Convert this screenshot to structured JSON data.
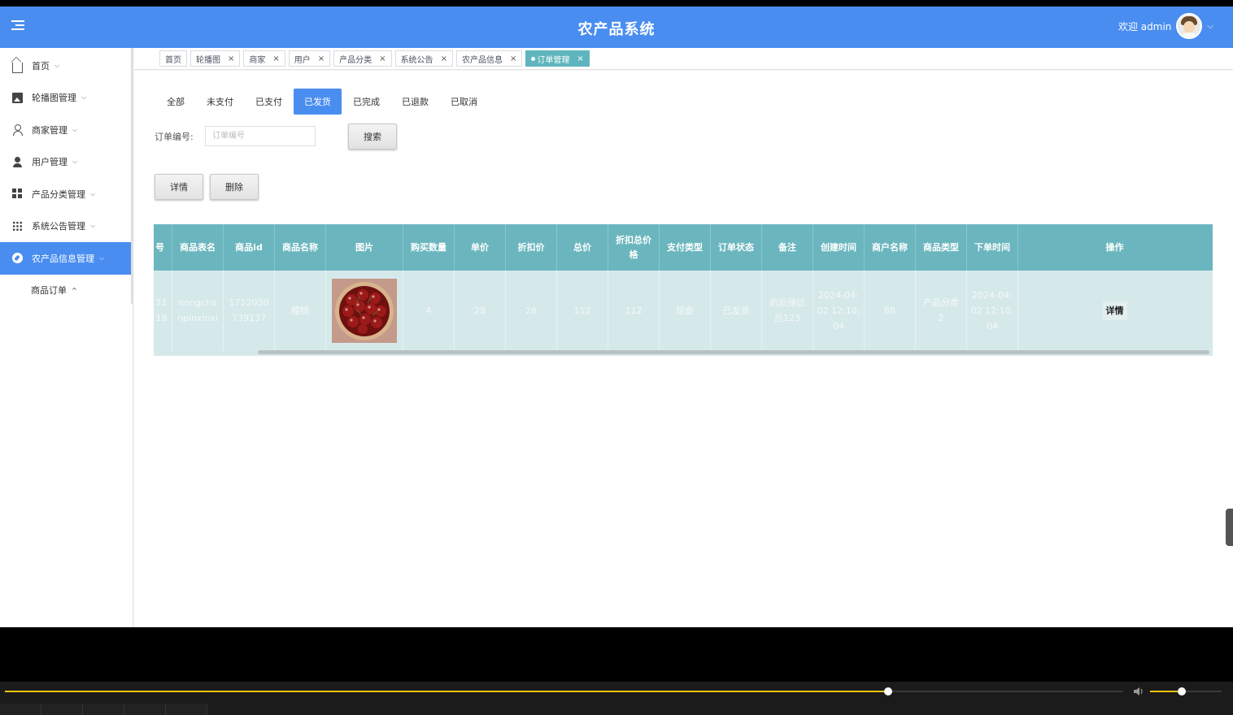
{
  "header": {
    "title": "农产品系统",
    "welcome": "欢迎 admin"
  },
  "sidebar": {
    "items": [
      {
        "label": "首页",
        "icon": "home-icon",
        "chevron": "⌵"
      },
      {
        "label": "轮播图管理",
        "icon": "image-icon",
        "chevron": "⌵"
      },
      {
        "label": "商家管理",
        "icon": "user-outline-icon",
        "chevron": "⌵"
      },
      {
        "label": "用户管理",
        "icon": "user-filled-icon",
        "chevron": "⌵"
      },
      {
        "label": "产品分类管理",
        "icon": "grid-icon",
        "chevron": "⌵"
      },
      {
        "label": "系统公告管理",
        "icon": "apps-icon",
        "chevron": "⌵"
      },
      {
        "label": "农产品信息管理",
        "icon": "compass-icon",
        "chevron": "⌵",
        "active": true
      }
    ],
    "sub_items": [
      {
        "label": "商品订单",
        "chevron": "^"
      }
    ]
  },
  "tags": [
    {
      "label": "首页",
      "closable": false
    },
    {
      "label": "轮播图",
      "closable": true
    },
    {
      "label": "商家",
      "closable": true
    },
    {
      "label": "用户",
      "closable": true
    },
    {
      "label": "产品分类",
      "closable": true
    },
    {
      "label": "系统公告",
      "closable": true
    },
    {
      "label": "农产品信息",
      "closable": true
    },
    {
      "label": "订单管理",
      "closable": true,
      "active": true
    }
  ],
  "tag_close": "×",
  "status_tabs": [
    "全部",
    "未支付",
    "已支付",
    "已发货",
    "已完成",
    "已退款",
    "已取消"
  ],
  "status_tab_active": "已发货",
  "search": {
    "label": "订单编号:",
    "placeholder": "订单编号",
    "button": "搜索"
  },
  "actions": {
    "detail": "详情",
    "delete": "删除"
  },
  "table": {
    "columns": [
      "号",
      "商品表名",
      "商品id",
      "商品名称",
      "图片",
      "购买数量",
      "单价",
      "折扣价",
      "总价",
      "折扣总价格",
      "支付类型",
      "订单状态",
      "备注",
      "创建时间",
      "商户名称",
      "商品类型",
      "下单时间",
      "操作"
    ],
    "rows": [
      {
        "cells": [
          "21 19",
          "nongcha npinxinxi",
          "1712030 739137",
          "樱桃",
          "",
          "4",
          "28",
          "28",
          "112",
          "112",
          "现金",
          "已发货",
          "的反弹过 后123",
          "2024-04- 02 12:10: 04",
          "88",
          "产品分类 2",
          "2024-04- 02 12:10: 04",
          ""
        ],
        "op_label": "详情"
      }
    ]
  },
  "player": {
    "progress": 0.79,
    "volume": 0.44
  },
  "colors": {
    "primary": "#4a8df0",
    "table_header": "#6bb6be",
    "table_row": "#d6e9ea",
    "active_tag": "#5fb5bd",
    "player_accent": "#f2c611"
  }
}
